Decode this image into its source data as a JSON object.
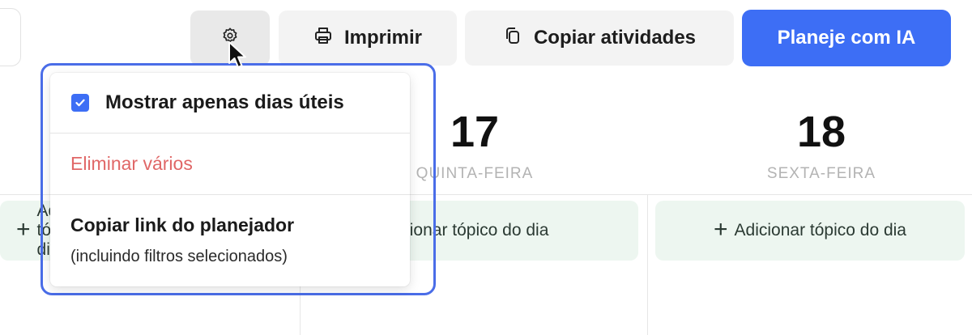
{
  "toolbar": {
    "print_label": "Imprimir",
    "copy_label": "Copiar atividades",
    "ai_label": "Planeje com IA",
    "icons": {
      "settings": "gear-icon",
      "print": "printer-icon",
      "copy": "copy-icon"
    }
  },
  "planner": {
    "days": [
      {
        "number": "17",
        "name": "QUINTA-FEIRA"
      },
      {
        "number": "18",
        "name": "SEXTA-FEIRA"
      }
    ],
    "topic_buttons": [
      {
        "label": "Adicionar tópico do dia",
        "visible_text": "+ A"
      },
      {
        "label": "icionar tópico do dia"
      },
      {
        "label": "Adicionar tópico do dia"
      }
    ]
  },
  "dropdown": {
    "show_weekdays_label": "Mostrar apenas dias úteis",
    "show_weekdays_checked": true,
    "delete_multiple_label": "Eliminar vários",
    "copy_link_label": "Copiar link do planejador",
    "copy_link_sublabel": "(incluindo filtros selecionados)"
  },
  "colors": {
    "primary": "#3d6ef5",
    "danger_text": "#e06767",
    "topic_bg": "#edf6f0",
    "highlight_border": "#4a6de8"
  }
}
